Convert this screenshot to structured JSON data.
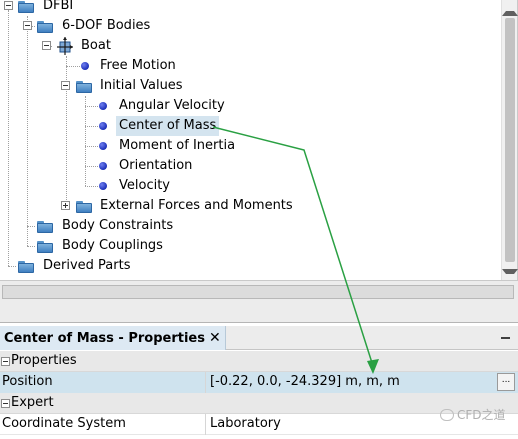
{
  "tree": {
    "items": [
      {
        "label": "DFBI",
        "icon": "folder-icon",
        "toggle": "minus"
      },
      {
        "label": "6-DOF Bodies",
        "icon": "folder-icon",
        "toggle": "minus"
      },
      {
        "label": "Boat",
        "icon": "rigid-body-icon",
        "toggle": "minus"
      },
      {
        "label": "Free Motion",
        "icon": "node-dot-icon"
      },
      {
        "label": "Initial Values",
        "icon": "folder-icon",
        "toggle": "minus"
      },
      {
        "label": "Angular Velocity",
        "icon": "node-dot-icon"
      },
      {
        "label": "Center of Mass",
        "icon": "node-dot-icon",
        "selected": true
      },
      {
        "label": "Moment of Inertia",
        "icon": "node-dot-icon"
      },
      {
        "label": "Orientation",
        "icon": "node-dot-icon"
      },
      {
        "label": "Velocity",
        "icon": "node-dot-icon"
      },
      {
        "label": "External Forces and Moments",
        "icon": "folder-icon",
        "toggle": "plus"
      },
      {
        "label": "Body Constraints",
        "icon": "folder-icon"
      },
      {
        "label": "Body Couplings",
        "icon": "folder-icon"
      },
      {
        "label": "Derived Parts",
        "icon": "folder-icon"
      }
    ]
  },
  "properties": {
    "tab_title": "Center of Mass - Properties",
    "close_glyph": "✕",
    "categories": [
      {
        "label": "Properties",
        "rows": [
          {
            "name": "Position",
            "value": "[-0.22, 0.0, -24.329] m, m, m",
            "editor_button": "..."
          }
        ]
      },
      {
        "label": "Expert",
        "rows": [
          {
            "name": "Coordinate System",
            "value": "Laboratory"
          }
        ]
      }
    ]
  },
  "watermark": {
    "text": "CFD之道"
  },
  "colors": {
    "selection": "#d4e4ef",
    "folder": "#4a87c4",
    "node_dot": "#2233c4",
    "annotation_arrow": "#2aa043",
    "properties_tab": "#dde9f3"
  }
}
